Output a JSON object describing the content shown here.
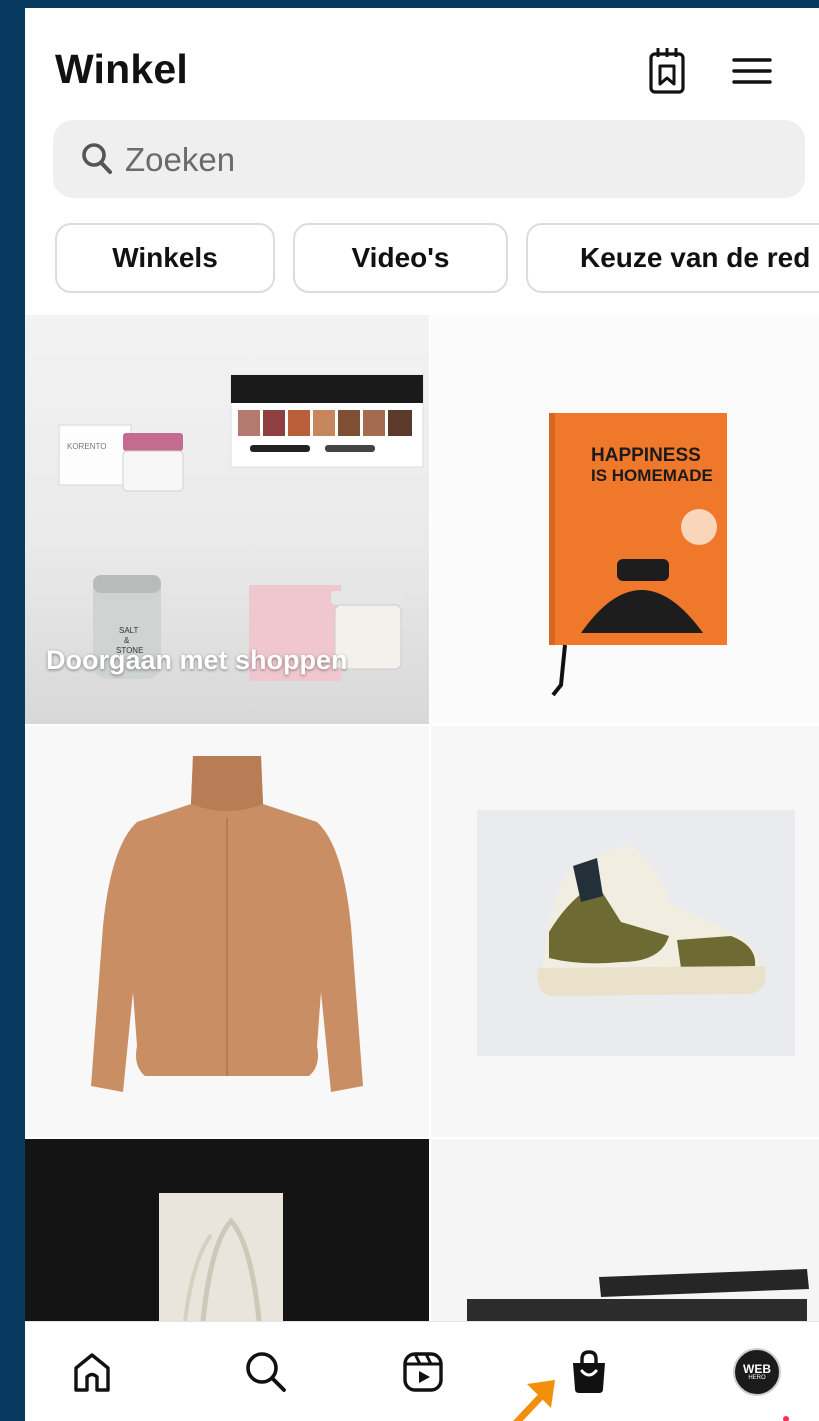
{
  "header": {
    "title": "Winkel"
  },
  "search": {
    "placeholder": "Zoeken"
  },
  "chips": [
    "Winkels",
    "Video's",
    "Keuze van de red"
  ],
  "tiles": {
    "continue_label": "Doorgaan met shoppen",
    "book_title_line1": "HAPPINESS",
    "book_title_line2": "IS HOMEMADE",
    "korento_label": "KORENTO",
    "salt_label_1": "SALT",
    "salt_label_2": "&",
    "salt_label_3": "STONE"
  },
  "profile": {
    "avatar_line1": "WEB",
    "avatar_line2": "HERO"
  },
  "colors": {
    "frame": "#083a5f",
    "accent_arrow": "#f2900e",
    "notification": "#ff2d55",
    "book": "#f0782a"
  }
}
